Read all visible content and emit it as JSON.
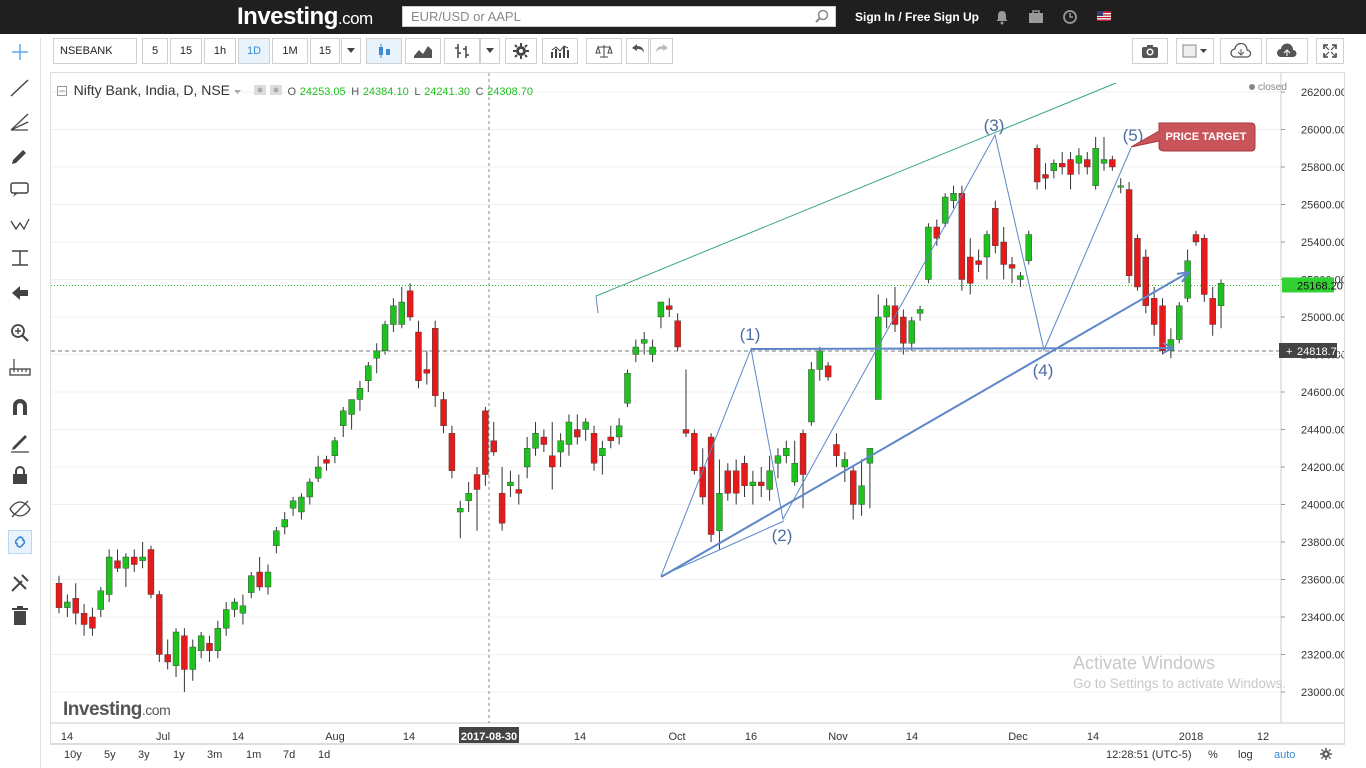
{
  "header": {
    "logo": "Investing",
    "logo_suffix": ".com",
    "search_placeholder": "EUR/USD or AAPL",
    "signin": "Sign In / Free Sign Up"
  },
  "toolbar": {
    "symbol": "NSEBANK",
    "intervals": [
      "5",
      "15",
      "1h",
      "1D",
      "1M",
      "15"
    ],
    "active_interval": "1D"
  },
  "legend": {
    "title": "Nifty Bank, India, D, NSE",
    "open_label": "O",
    "open": "24253.05",
    "high_label": "H",
    "high": "24384.10",
    "low_label": "L",
    "low": "24241.30",
    "close_label": "C",
    "close": "24308.70",
    "status": "closed"
  },
  "price_axis": {
    "labels": [
      "26200.00",
      "26000.00",
      "25800.00",
      "25600.00",
      "25400.00",
      "25200.00",
      "25000.00",
      "24800.00",
      "24600.00",
      "24400.00",
      "24200.00",
      "24000.00",
      "23800.00",
      "23600.00",
      "23400.00",
      "23200.00",
      "23000.00"
    ],
    "last_price": "25168.20",
    "crosshair_price": "24818.75"
  },
  "time_axis": {
    "labels": [
      "14",
      "Jul",
      "14",
      "Aug",
      "14",
      "14",
      "Oct",
      "16",
      "Nov",
      "14",
      "Dec",
      "14",
      "2018",
      "12"
    ],
    "crosshair_date": "2017-08-30"
  },
  "annotations": {
    "wave_labels": [
      "(1)",
      "(2)",
      "(3)",
      "(4)",
      "(5)"
    ],
    "price_target": "PRICE TARGET",
    "watermark_logo": "Investing",
    "watermark_suffix": ".com"
  },
  "activate": {
    "line1": "Activate Windows",
    "line2": "Go to Settings to activate Windows."
  },
  "bottom": {
    "ranges": [
      "10y",
      "5y",
      "3y",
      "1y",
      "3m",
      "1m",
      "7d",
      "1d"
    ],
    "time": "12:28:51 (UTC-5)",
    "pct": "%",
    "log": "log",
    "auto": "auto"
  },
  "colors": {
    "up": "#1fc11f",
    "down": "#e31b1b",
    "wave_line": "#5d87c9",
    "channel_line": "#3aa68a",
    "target_fill": "#c9545a"
  },
  "chart_data": {
    "type": "candlestick",
    "title": "Nifty Bank, India, D, NSE",
    "ylim": [
      22850,
      26300
    ],
    "candles": [
      {
        "o": 23580,
        "h": 23620,
        "l": 23420,
        "c": 23450
      },
      {
        "o": 23450,
        "h": 23520,
        "l": 23400,
        "c": 23480
      },
      {
        "o": 23500,
        "h": 23580,
        "l": 23360,
        "c": 23420
      },
      {
        "o": 23420,
        "h": 23470,
        "l": 23300,
        "c": 23360
      },
      {
        "o": 23400,
        "h": 23450,
        "l": 23300,
        "c": 23340
      },
      {
        "o": 23440,
        "h": 23560,
        "l": 23400,
        "c": 23540
      },
      {
        "o": 23520,
        "h": 23760,
        "l": 23480,
        "c": 23720
      },
      {
        "o": 23700,
        "h": 23760,
        "l": 23640,
        "c": 23660
      },
      {
        "o": 23660,
        "h": 23740,
        "l": 23560,
        "c": 23720
      },
      {
        "o": 23720,
        "h": 23760,
        "l": 23640,
        "c": 23680
      },
      {
        "o": 23700,
        "h": 23800,
        "l": 23660,
        "c": 23720
      },
      {
        "o": 23760,
        "h": 23780,
        "l": 23500,
        "c": 23520
      },
      {
        "o": 23520,
        "h": 23540,
        "l": 23160,
        "c": 23200
      },
      {
        "o": 23200,
        "h": 23280,
        "l": 23120,
        "c": 23160
      },
      {
        "o": 23140,
        "h": 23340,
        "l": 23080,
        "c": 23320
      },
      {
        "o": 23300,
        "h": 23340,
        "l": 23000,
        "c": 23120
      },
      {
        "o": 23120,
        "h": 23280,
        "l": 23060,
        "c": 23240
      },
      {
        "o": 23220,
        "h": 23320,
        "l": 23180,
        "c": 23300
      },
      {
        "o": 23260,
        "h": 23300,
        "l": 23160,
        "c": 23220
      },
      {
        "o": 23220,
        "h": 23380,
        "l": 23180,
        "c": 23340
      },
      {
        "o": 23340,
        "h": 23480,
        "l": 23300,
        "c": 23440
      },
      {
        "o": 23440,
        "h": 23500,
        "l": 23400,
        "c": 23480
      },
      {
        "o": 23420,
        "h": 23520,
        "l": 23360,
        "c": 23460
      },
      {
        "o": 23530,
        "h": 23640,
        "l": 23500,
        "c": 23620
      },
      {
        "o": 23640,
        "h": 23720,
        "l": 23540,
        "c": 23560
      },
      {
        "o": 23560,
        "h": 23680,
        "l": 23520,
        "c": 23640
      },
      {
        "o": 23780,
        "h": 23880,
        "l": 23740,
        "c": 23860
      },
      {
        "o": 23880,
        "h": 23960,
        "l": 23840,
        "c": 23920
      },
      {
        "o": 23980,
        "h": 24040,
        "l": 23940,
        "c": 24020
      },
      {
        "o": 23960,
        "h": 24060,
        "l": 23920,
        "c": 24040
      },
      {
        "o": 24040,
        "h": 24140,
        "l": 24000,
        "c": 24120
      },
      {
        "o": 24140,
        "h": 24260,
        "l": 24120,
        "c": 24200
      },
      {
        "o": 24240,
        "h": 24260,
        "l": 24180,
        "c": 24220
      },
      {
        "o": 24260,
        "h": 24360,
        "l": 24220,
        "c": 24340
      },
      {
        "o": 24420,
        "h": 24520,
        "l": 24360,
        "c": 24500
      },
      {
        "o": 24480,
        "h": 24560,
        "l": 24400,
        "c": 24560
      },
      {
        "o": 24560,
        "h": 24660,
        "l": 24500,
        "c": 24620
      },
      {
        "o": 24660,
        "h": 24760,
        "l": 24600,
        "c": 24740
      },
      {
        "o": 24780,
        "h": 24860,
        "l": 24700,
        "c": 24820
      },
      {
        "o": 24820,
        "h": 24980,
        "l": 24800,
        "c": 24960
      },
      {
        "o": 24960,
        "h": 25100,
        "l": 24920,
        "c": 25060
      },
      {
        "o": 24960,
        "h": 25160,
        "l": 24940,
        "c": 25080
      },
      {
        "o": 25140,
        "h": 25180,
        "l": 24980,
        "c": 25000
      },
      {
        "o": 24920,
        "h": 24980,
        "l": 24620,
        "c": 24660
      },
      {
        "o": 24720,
        "h": 24820,
        "l": 24640,
        "c": 24700
      },
      {
        "o": 24940,
        "h": 24980,
        "l": 24520,
        "c": 24580
      },
      {
        "o": 24560,
        "h": 24600,
        "l": 24380,
        "c": 24420
      },
      {
        "o": 24380,
        "h": 24420,
        "l": 24140,
        "c": 24180
      },
      {
        "o": 23960,
        "h": 24020,
        "l": 23820,
        "c": 23980
      },
      {
        "o": 24020,
        "h": 24120,
        "l": 23960,
        "c": 24060
      },
      {
        "o": 24160,
        "h": 24200,
        "l": 23860,
        "c": 24080
      },
      {
        "o": 24500,
        "h": 24520,
        "l": 24100,
        "c": 24160
      },
      {
        "o": 24340,
        "h": 24440,
        "l": 24260,
        "c": 24280
      },
      {
        "o": 24060,
        "h": 24200,
        "l": 23860,
        "c": 23900
      },
      {
        "o": 24100,
        "h": 24180,
        "l": 24040,
        "c": 24120
      },
      {
        "o": 24080,
        "h": 24160,
        "l": 24000,
        "c": 24060
      },
      {
        "o": 24200,
        "h": 24360,
        "l": 24140,
        "c": 24300
      },
      {
        "o": 24300,
        "h": 24440,
        "l": 24260,
        "c": 24380
      },
      {
        "o": 24360,
        "h": 24400,
        "l": 24280,
        "c": 24320
      },
      {
        "o": 24260,
        "h": 24440,
        "l": 24080,
        "c": 24200
      },
      {
        "o": 24280,
        "h": 24380,
        "l": 24200,
        "c": 24340
      },
      {
        "o": 24320,
        "h": 24480,
        "l": 24260,
        "c": 24440
      },
      {
        "o": 24400,
        "h": 24480,
        "l": 24320,
        "c": 24360
      },
      {
        "o": 24400,
        "h": 24460,
        "l": 24340,
        "c": 24440
      },
      {
        "o": 24380,
        "h": 24420,
        "l": 24180,
        "c": 24220
      },
      {
        "o": 24260,
        "h": 24340,
        "l": 24160,
        "c": 24300
      },
      {
        "o": 24360,
        "h": 24420,
        "l": 24300,
        "c": 24340
      },
      {
        "o": 24360,
        "h": 24460,
        "l": 24320,
        "c": 24420
      },
      {
        "o": 24540,
        "h": 24720,
        "l": 24520,
        "c": 24700
      },
      {
        "o": 24800,
        "h": 24880,
        "l": 24760,
        "c": 24840
      },
      {
        "o": 24860,
        "h": 24920,
        "l": 24800,
        "c": 24880
      },
      {
        "o": 24800,
        "h": 24880,
        "l": 24760,
        "c": 24840
      },
      {
        "o": 25000,
        "h": 25080,
        "l": 24940,
        "c": 25080
      },
      {
        "o": 25060,
        "h": 25100,
        "l": 25000,
        "c": 25040
      },
      {
        "o": 24980,
        "h": 25020,
        "l": 24820,
        "c": 24840
      },
      {
        "o": 24400,
        "h": 24720,
        "l": 24360,
        "c": 24380
      },
      {
        "o": 24380,
        "h": 24400,
        "l": 24160,
        "c": 24180
      },
      {
        "o": 24200,
        "h": 24300,
        "l": 24000,
        "c": 24040
      },
      {
        "o": 24360,
        "h": 24380,
        "l": 23800,
        "c": 23840
      },
      {
        "o": 23860,
        "h": 24240,
        "l": 23760,
        "c": 24060
      },
      {
        "o": 24180,
        "h": 24220,
        "l": 24020,
        "c": 24060
      },
      {
        "o": 24180,
        "h": 24240,
        "l": 24000,
        "c": 24060
      },
      {
        "o": 24220,
        "h": 24260,
        "l": 24040,
        "c": 24100
      },
      {
        "o": 24100,
        "h": 24180,
        "l": 24000,
        "c": 24120
      },
      {
        "o": 24120,
        "h": 24200,
        "l": 24040,
        "c": 24100
      },
      {
        "o": 24080,
        "h": 24260,
        "l": 24020,
        "c": 24180
      },
      {
        "o": 24220,
        "h": 24300,
        "l": 24140,
        "c": 24260
      },
      {
        "o": 24260,
        "h": 24340,
        "l": 24220,
        "c": 24300
      },
      {
        "o": 24120,
        "h": 24340,
        "l": 24100,
        "c": 24220
      },
      {
        "o": 24380,
        "h": 24400,
        "l": 23980,
        "c": 24160
      },
      {
        "o": 24440,
        "h": 24760,
        "l": 24420,
        "c": 24720
      },
      {
        "o": 24720,
        "h": 24840,
        "l": 24660,
        "c": 24820
      },
      {
        "o": 24740,
        "h": 24760,
        "l": 24660,
        "c": 24680
      },
      {
        "o": 24320,
        "h": 24380,
        "l": 24200,
        "c": 24260
      },
      {
        "o": 24200,
        "h": 24280,
        "l": 24120,
        "c": 24240
      },
      {
        "o": 24180,
        "h": 24200,
        "l": 23920,
        "c": 24000
      },
      {
        "o": 24000,
        "h": 24240,
        "l": 23940,
        "c": 24100
      },
      {
        "o": 24220,
        "h": 24280,
        "l": 23980,
        "c": 24300
      },
      {
        "o": 24560,
        "h": 25120,
        "l": 24560,
        "c": 25000
      },
      {
        "o": 25000,
        "h": 25100,
        "l": 24940,
        "c": 25060
      },
      {
        "o": 25060,
        "h": 25160,
        "l": 24920,
        "c": 24960
      },
      {
        "o": 25000,
        "h": 25040,
        "l": 24800,
        "c": 24860
      },
      {
        "o": 24860,
        "h": 25000,
        "l": 24820,
        "c": 24980
      },
      {
        "o": 25020,
        "h": 25060,
        "l": 24980,
        "c": 25040
      },
      {
        "o": 25200,
        "h": 25500,
        "l": 25180,
        "c": 25480
      },
      {
        "o": 25480,
        "h": 25520,
        "l": 25380,
        "c": 25420
      },
      {
        "o": 25500,
        "h": 25660,
        "l": 25480,
        "c": 25640
      },
      {
        "o": 25620,
        "h": 25700,
        "l": 25580,
        "c": 25660
      },
      {
        "o": 25660,
        "h": 25700,
        "l": 25140,
        "c": 25200
      },
      {
        "o": 25320,
        "h": 25420,
        "l": 25120,
        "c": 25180
      },
      {
        "o": 25300,
        "h": 25360,
        "l": 25240,
        "c": 25280
      },
      {
        "o": 25320,
        "h": 25460,
        "l": 25200,
        "c": 25440
      },
      {
        "o": 25580,
        "h": 25620,
        "l": 25340,
        "c": 25380
      },
      {
        "o": 25400,
        "h": 25480,
        "l": 25200,
        "c": 25280
      },
      {
        "o": 25280,
        "h": 25320,
        "l": 25180,
        "c": 25260
      },
      {
        "o": 25200,
        "h": 25240,
        "l": 25160,
        "c": 25220
      },
      {
        "o": 25300,
        "h": 25460,
        "l": 25280,
        "c": 25440
      },
      {
        "o": 25900,
        "h": 25920,
        "l": 25680,
        "c": 25720
      },
      {
        "o": 25760,
        "h": 25820,
        "l": 25680,
        "c": 25740
      },
      {
        "o": 25780,
        "h": 25840,
        "l": 25740,
        "c": 25820
      },
      {
        "o": 25820,
        "h": 25880,
        "l": 25760,
        "c": 25800
      },
      {
        "o": 25840,
        "h": 25880,
        "l": 25680,
        "c": 25760
      },
      {
        "o": 25820,
        "h": 25900,
        "l": 25760,
        "c": 25860
      },
      {
        "o": 25840,
        "h": 25880,
        "l": 25760,
        "c": 25800
      },
      {
        "o": 25700,
        "h": 25960,
        "l": 25680,
        "c": 25900
      },
      {
        "o": 25820,
        "h": 25960,
        "l": 25780,
        "c": 25840
      },
      {
        "o": 25840,
        "h": 25860,
        "l": 25780,
        "c": 25800
      },
      {
        "o": 25700,
        "h": 25740,
        "l": 25660,
        "c": 25700
      },
      {
        "o": 25680,
        "h": 25720,
        "l": 25180,
        "c": 25220
      },
      {
        "o": 25420,
        "h": 25440,
        "l": 25140,
        "c": 25160
      },
      {
        "o": 25320,
        "h": 25360,
        "l": 25020,
        "c": 25060
      },
      {
        "o": 25100,
        "h": 25160,
        "l": 24900,
        "c": 24960
      },
      {
        "o": 25060,
        "h": 25100,
        "l": 24800,
        "c": 24820
      },
      {
        "o": 24820,
        "h": 24940,
        "l": 24780,
        "c": 24880
      },
      {
        "o": 24880,
        "h": 25080,
        "l": 24860,
        "c": 25060
      },
      {
        "o": 25100,
        "h": 25360,
        "l": 25080,
        "c": 25300
      },
      {
        "o": 25440,
        "h": 25460,
        "l": 25380,
        "c": 25400
      },
      {
        "o": 25420,
        "h": 25440,
        "l": 25080,
        "c": 25120
      },
      {
        "o": 25100,
        "h": 25160,
        "l": 24900,
        "c": 24960
      },
      {
        "o": 25060,
        "h": 25200,
        "l": 24940,
        "c": 25180
      }
    ],
    "horizontal_lines": [
      {
        "price": 25168.2,
        "style": "dotted",
        "color": "#1fc11f"
      },
      {
        "price": 24818.75,
        "style": "dashed",
        "color": "#777"
      }
    ],
    "wave_points": [
      {
        "label": "(1)",
        "price": 24840
      },
      {
        "label": "(2)",
        "price": 23940
      },
      {
        "label": "(3)",
        "price": 25960
      },
      {
        "label": "(4)",
        "price": 24800
      },
      {
        "label": "(5)",
        "price": 25880
      }
    ]
  }
}
